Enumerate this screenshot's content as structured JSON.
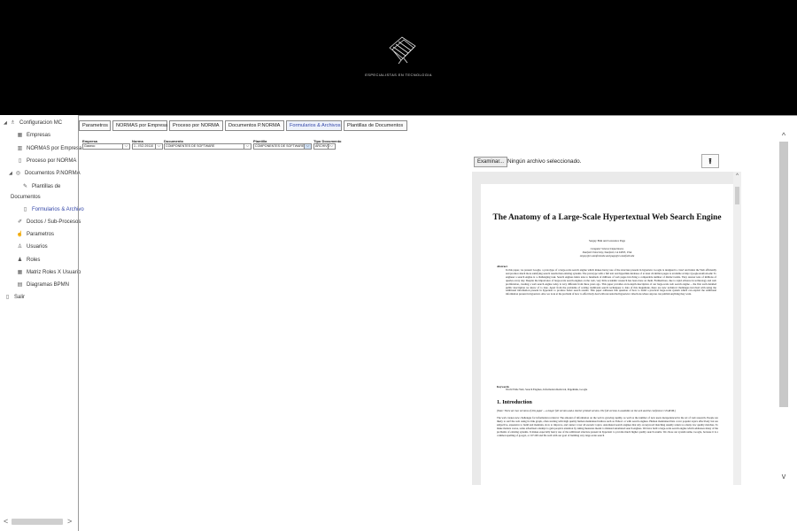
{
  "header": {
    "tagline": "ESPECIALISTAS EN TECNOLOGIA"
  },
  "sidebar": {
    "items": [
      {
        "label": "Configuracion MC",
        "icon": "org-icon",
        "expanded": true
      },
      {
        "label": "Empresas",
        "icon": "building-icon"
      },
      {
        "label": "NORMAS por Empresa",
        "icon": "doc-icon"
      },
      {
        "label": "Proceso por NORMA",
        "icon": "page-icon"
      },
      {
        "label": "Documentos P.NORMA",
        "icon": "globe-icon",
        "expanded": true
      },
      {
        "label": "Plantillas de",
        "icon": "template-icon"
      },
      {
        "label": "Documentos",
        "icon": ""
      },
      {
        "label": "Formularios & Archivo",
        "icon": "file-icon",
        "active": true
      },
      {
        "label": "Doctos / Sub-Procesos",
        "icon": "edit-icon"
      },
      {
        "label": "Parametros",
        "icon": "hand-icon"
      },
      {
        "label": "Usuarios",
        "icon": "user-icon"
      },
      {
        "label": "Roles",
        "icon": "users-icon"
      },
      {
        "label": "Matriz Roles X Usuario",
        "icon": "grid-icon"
      },
      {
        "label": "Diagramas BPMN",
        "icon": "diagram-icon"
      },
      {
        "label": "Salir",
        "icon": "exit-icon"
      }
    ],
    "scroll_left": "<",
    "scroll_right": ">"
  },
  "tabs": [
    {
      "label": "Parametros"
    },
    {
      "label": "NORMAS por Empresa"
    },
    {
      "label": "Proceso por NORMA"
    },
    {
      "label": "Documentos P.NORMA"
    },
    {
      "label": "Formularios & Archivos",
      "active": true,
      "close": "X"
    },
    {
      "label": "Plantillas de Documentos"
    }
  ],
  "filters": {
    "empresa": {
      "label": "Empresa",
      "value": "Gaseco"
    },
    "norma": {
      "label": "Norma",
      "value": "1 - ISO 29110"
    },
    "documento": {
      "label": "Documento",
      "value": "COMPONENTES DE SOFTWARE"
    },
    "plantilla": {
      "label": "Plantilla",
      "value": "COMPONENTES DE SOFTWARE"
    },
    "tipo_documento": {
      "label": "Tipo Documento",
      "value": "ARCHIVO"
    }
  },
  "upload": {
    "button": "Examinar...",
    "status": "Ningún archivo seleccionado.",
    "upload_icon": "upload-icon"
  },
  "pdf": {
    "title": "The Anatomy of a Large-Scale Hypertextual Web Search Engine",
    "authors": "Sergey Brin and Lawrence Page",
    "affiliation_1": "Computer Science Department,",
    "affiliation_2": "Stanford University, Stanford, CA 94305, USA",
    "affiliation_3": "sergey@cs.stanford.edu and page@cs.stanford.edu",
    "abstract_heading": "Abstract",
    "abstract": "In this paper, we present Google, a prototype of a large-scale search engine which makes heavy use of the structure present in hypertext. Google is designed to crawl and index the Web efficiently and produce much more satisfying search results than existing systems. The prototype with a full text and hyperlink database of at least 24 million pages is available at http://google.stanford.edu/ To engineer a search engine is a challenging task. Search engines index tens to hundreds of millions of web pages involving a comparable number of distinct terms. They answer tens of millions of queries every day. Despite the importance of large-scale search engines on the web, very little academic research has been done on them. Furthermore, due to rapid advance in technology and web proliferation, creating a web search engine today is very different from three years ago. This paper provides an in-depth description of our large-scale web search engine -- the first such detailed public description we know of to date. Apart from the problems of scaling traditional search techniques to data of this magnitude, there are new technical challenges involved with using the additional information present in hypertext to produce better search results. This paper addresses this question of how to build a practical large-scale system which can exploit the additional information present in hypertext. Also we look at the problem of how to effectively deal with uncontrolled hypertext collections where anyone can publish anything they want.",
    "keywords_heading": "Keywords",
    "keywords": "World Wide Web, Search Engines, Information Retrieval, PageRank, Google",
    "section_heading": "1. Introduction",
    "note": "(Note: There are two versions of this paper -- a longer full version and a shorter printed version. The full version is available on the web and the conference CD-ROM.)",
    "intro": "The web creates new challenges for information retrieval. The amount of information on the web is growing rapidly, as well as the number of new users inexperienced in the art of web research. People are likely to surf the web using its link graph, often starting with high quality human maintained indices such as Yahoo! or with search engines. Human maintained lists cover popular topics effectively but are subjective, expensive to build and maintain, slow to improve, and cannot cover all esoteric topics. Automated search engines that rely on keyword matching usually return too many low quality matches. To make matters worse, some advertisers attempt to gain people's attention by taking measures meant to mislead automated search engines. We have built a large-scale search engine which addresses many of the problems of existing systems. It makes especially heavy use of the additional structure present in hypertext to provide much higher quality search results. We chose our system name, Google, because it is a common spelling of googol, or 10^100 and fits well with our goal of building very large-scale search"
  },
  "main_scroll": {
    "up": "^",
    "down": "v"
  }
}
